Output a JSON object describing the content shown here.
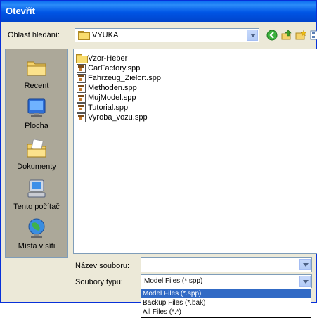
{
  "window": {
    "title": "Otevřít"
  },
  "look_in": {
    "label": "Oblast hledání:",
    "value": "VYUKA"
  },
  "places": [
    {
      "label": "Recent",
      "icon": "recent-folder-icon"
    },
    {
      "label": "Plocha",
      "icon": "desktop-icon"
    },
    {
      "label": "Dokumenty",
      "icon": "documents-folder-icon"
    },
    {
      "label": "Tento počítač",
      "icon": "computer-icon"
    },
    {
      "label": "Místa v síti",
      "icon": "network-icon"
    }
  ],
  "files": [
    {
      "name": "Vzor-Heber",
      "type": "folder"
    },
    {
      "name": "CarFactory.spp",
      "type": "spp"
    },
    {
      "name": "Fahrzeug_Zielort.spp",
      "type": "spp"
    },
    {
      "name": "Methoden.spp",
      "type": "spp"
    },
    {
      "name": "MujModel.spp",
      "type": "spp"
    },
    {
      "name": "Tutorial.spp",
      "type": "spp"
    },
    {
      "name": "Vyroba_vozu.spp",
      "type": "spp"
    }
  ],
  "filename": {
    "label": "Název souboru:",
    "value": ""
  },
  "filetype": {
    "label": "Soubory typu:",
    "value": "Model Files (*.spp)",
    "options": [
      "Model Files (*.spp)",
      "Backup Files (*.bak)",
      "All Files (*.*)"
    ],
    "selected_index": 0
  },
  "colors": {
    "titlebar": "#0054e3",
    "dialog_bg": "#ece9d8",
    "selection": "#316ac5"
  }
}
